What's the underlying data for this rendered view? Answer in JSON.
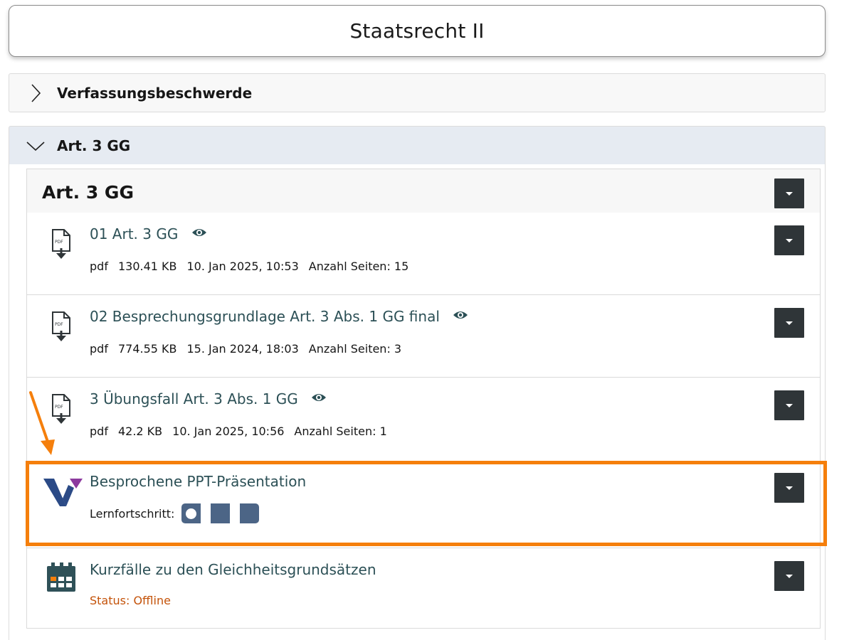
{
  "page": {
    "title": "Staatsrecht II"
  },
  "accordions": [
    {
      "label": "Verfassungsbeschwerde",
      "state": "collapsed",
      "icon": "chevron-right-icon"
    },
    {
      "label": "Art. 3 GG",
      "state": "expanded",
      "icon": "chevron-down-icon"
    }
  ],
  "block": {
    "title": "Art. 3 GG",
    "items": [
      {
        "title": "01 Art. 3 GG",
        "type": "pdf",
        "size": "130.41 KB",
        "date": "10. Jan 2025, 10:53",
        "pages": "Anzahl Seiten: 15",
        "icon": "pdf-download-icon"
      },
      {
        "title": "02 Besprechungsgrundlage Art. 3 Abs. 1 GG final",
        "type": "pdf",
        "size": "774.55 KB",
        "date": "15. Jan 2024, 18:03",
        "pages": "Anzahl Seiten: 3",
        "icon": "pdf-download-icon"
      },
      {
        "title": "3 Übungsfall Art. 3 Abs. 1 GG",
        "type": "pdf",
        "size": "42.2 KB",
        "date": "10. Jan 2025, 10:56",
        "pages": "Anzahl Seiten: 1",
        "icon": "pdf-download-icon"
      },
      {
        "title": "Besprochene PPT-Präsentation",
        "progress_label": "Lernfortschritt:",
        "progress_segments": 3,
        "progress_current": 1,
        "icon": "v-logo-icon"
      },
      {
        "title": "Kurzfälle zu den Gleichheitsgrundsätzen",
        "status": "Status: Offline",
        "icon": "calendar-icon"
      }
    ]
  },
  "colors": {
    "link": "#2c5056",
    "accordion_active_bg": "#e6ebf2",
    "dropdown_bg": "#2f3538",
    "highlight": "#f57f0c",
    "progress": "#4c6586",
    "status_offline": "#c4530a",
    "logo_blue": "#2b4a86",
    "logo_purple": "#8c3a9e"
  }
}
